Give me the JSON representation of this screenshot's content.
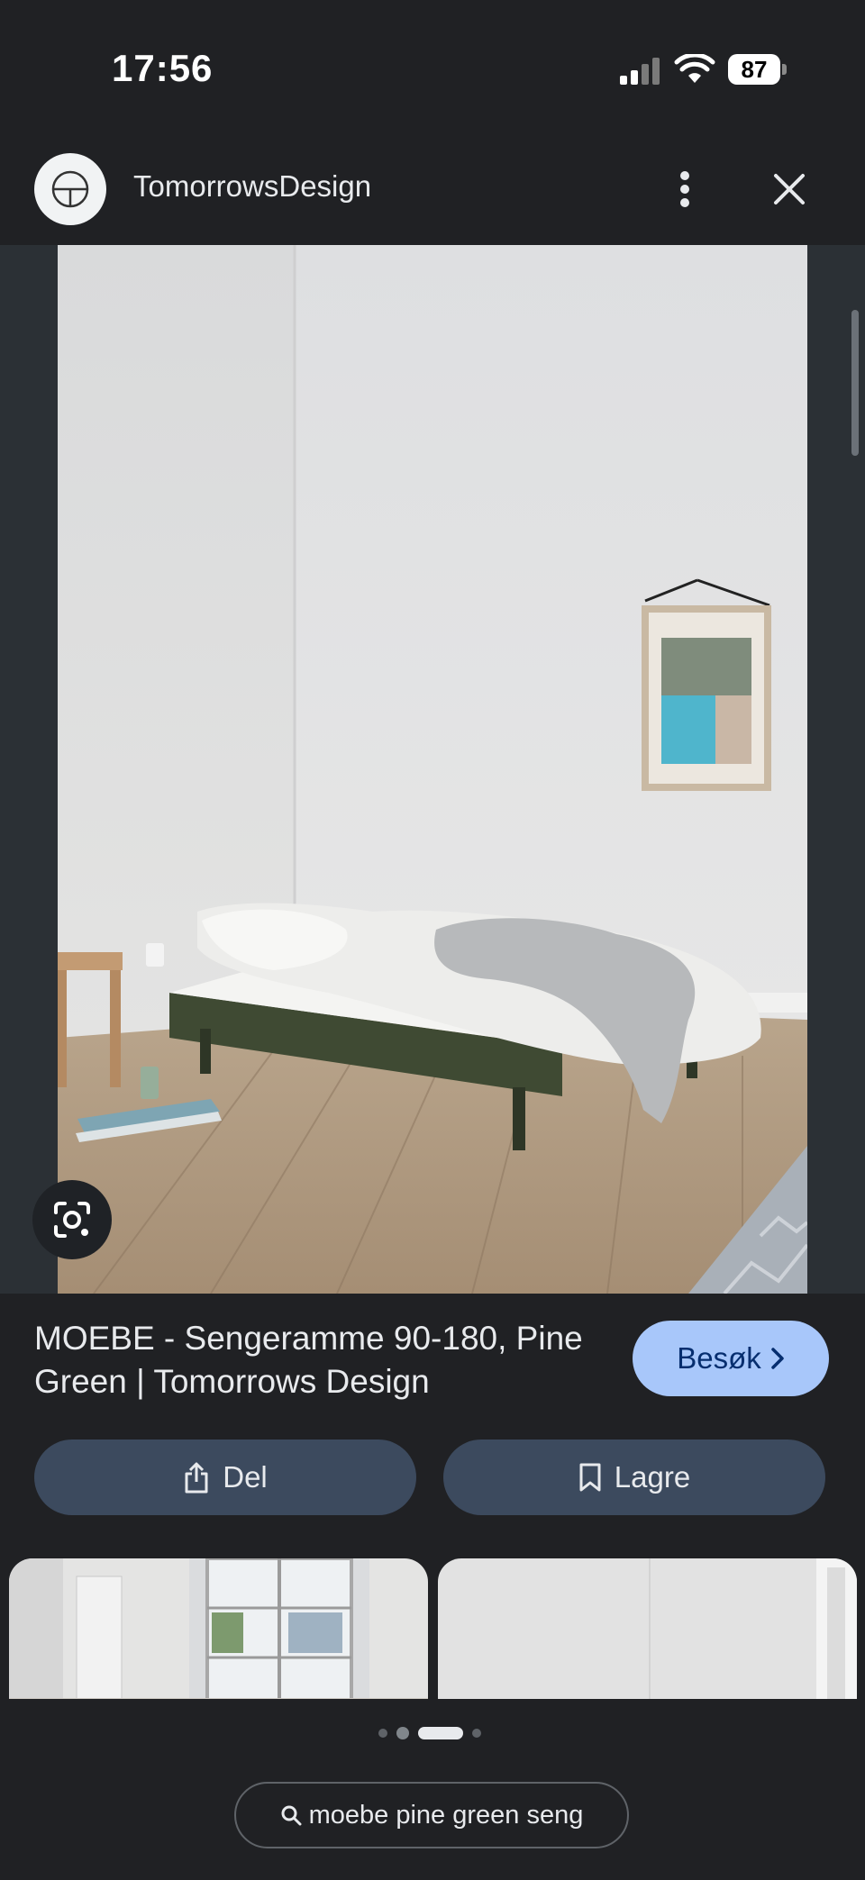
{
  "status_bar": {
    "time": "17:56",
    "battery": "87"
  },
  "header": {
    "site_name": "TomorrowsDesign"
  },
  "result": {
    "title": "MOEBE - Sengeramme 90-180, Pine Green | Tomorrows Design",
    "visit_label": "Besøk",
    "share_label": "Del",
    "save_label": "Lagre"
  },
  "carousel": {
    "page_count": 4,
    "active_index": 2
  },
  "search_chip": {
    "query": "moebe pine green seng"
  },
  "colors": {
    "background": "#202124",
    "visit_button": "#a8c7fa",
    "action_button": "#3c4a5e"
  },
  "icons": [
    "site-logo-icon",
    "more-vert-icon",
    "close-icon",
    "lens-icon",
    "chevron-right-icon",
    "share-icon",
    "bookmark-icon",
    "search-icon"
  ]
}
